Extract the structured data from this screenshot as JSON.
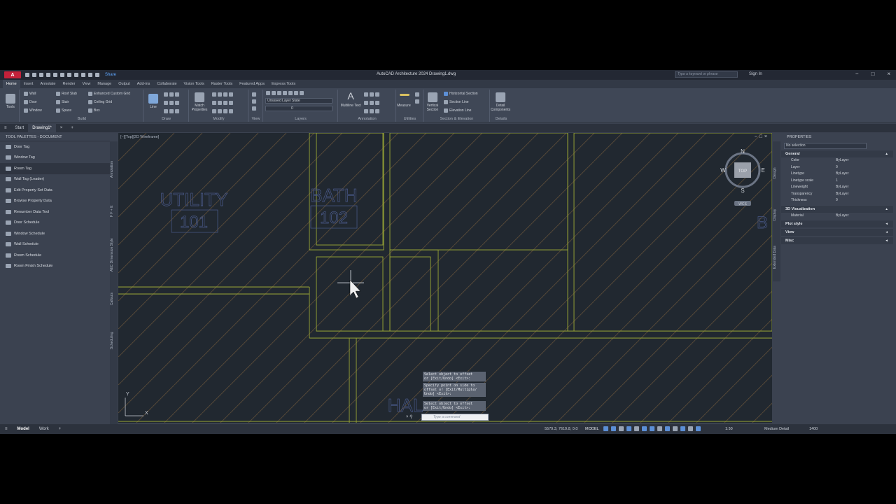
{
  "window": {
    "title": "AutoCAD Architecture 2024  Drawing1.dwg",
    "logo": "A",
    "share_label": "Share",
    "search_placeholder": "Type a keyword or phrase",
    "sign_in": "Sign In"
  },
  "menu_tabs": [
    "Home",
    "Insert",
    "Annotate",
    "Render",
    "View",
    "Manage",
    "Output",
    "Add-ins",
    "Collaborate",
    "Vision Tools",
    "Raster Tools",
    "Featured Apps",
    "Express Tools"
  ],
  "ribbon": {
    "tools_label": "Tools",
    "build": {
      "label": "Build",
      "items": [
        "Wall",
        "Roof Slab",
        "Enhanced Custom Grid",
        "Door",
        "Stair",
        "Ceiling Grid",
        "Window",
        "Space",
        "Box"
      ]
    },
    "draw": {
      "label": "Draw",
      "line": "Line"
    },
    "modify": {
      "label": "Modify",
      "match": "Match Properties"
    },
    "view": {
      "label": "View"
    },
    "layers": {
      "label": "Layers",
      "state": "Unsaved Layer State",
      "layer": "0"
    },
    "annotation": {
      "label": "Annotation",
      "text": "Multiline Text"
    },
    "utilities": {
      "label": "Utilities",
      "measure": "Measure"
    },
    "section": {
      "label": "Section & Elevation",
      "vertical": "Vertical Section",
      "items": [
        "Horizontal Section",
        "Section Line",
        "Elevation Line"
      ]
    },
    "details": {
      "label": "Details",
      "detail": "Detail Components"
    }
  },
  "doc_tabs": [
    "Start",
    "Drawing1*"
  ],
  "tool_palette": {
    "title": "TOOL PALETTES - DOCUMENT",
    "items": [
      "Door Tag",
      "Window Tag",
      "Room Tag",
      "Wall Tag (Leader)",
      "Edit Property Set Data",
      "Browse Property Data",
      "Renumber Data Tool",
      "Door Schedule",
      "Window Schedule",
      "Wall Schedule",
      "Room Schedule",
      "Room Finish Schedule"
    ],
    "selected": "Room Tag",
    "side_tabs": [
      "Annotation",
      "F F + E",
      "AEC Dimension Style",
      "Callouts",
      "Scheduling"
    ]
  },
  "viewport": {
    "label": "[−][Top][2D Wireframe]",
    "rooms": [
      {
        "name": "UTILITY",
        "number": "101"
      },
      {
        "name": "BATH",
        "number": "102"
      },
      {
        "name": "HAL"
      }
    ],
    "edge_letter": "B",
    "viewcube": {
      "top": "TOP",
      "n": "N",
      "s": "S",
      "e": "E",
      "w": "W",
      "wcs": "WCS"
    },
    "ucs": {
      "x": "X",
      "y": "Y"
    }
  },
  "command": {
    "history": [
      "Select object to offset\nor [Exit/Undo] <Exit>:",
      "Specify point on side to\noffset or [Exit/Multiple/\nUndo] <Exit>:",
      "Select object to offset\nor [Exit/Undo] <Exit>:"
    ],
    "placeholder": "Type a command"
  },
  "properties": {
    "title": "PROPERTIES",
    "selection": "No selection",
    "side_tabs": [
      "Design",
      "Display",
      "Extended Data"
    ],
    "sections": [
      {
        "name": "General",
        "expanded": true,
        "rows": [
          {
            "k": "Color",
            "v": "ByLayer"
          },
          {
            "k": "Layer",
            "v": "0"
          },
          {
            "k": "Linetype",
            "v": "ByLayer"
          },
          {
            "k": "Linetype scale",
            "v": "1"
          },
          {
            "k": "Lineweight",
            "v": "ByLayer"
          },
          {
            "k": "Transparency",
            "v": "ByLayer"
          },
          {
            "k": "Thickness",
            "v": "0"
          }
        ]
      },
      {
        "name": "3D Visualization",
        "expanded": true,
        "rows": [
          {
            "k": "Material",
            "v": "ByLayer"
          }
        ]
      },
      {
        "name": "Plot style",
        "expanded": false,
        "rows": []
      },
      {
        "name": "View",
        "expanded": false,
        "rows": []
      },
      {
        "name": "Misc",
        "expanded": false,
        "rows": []
      }
    ]
  },
  "status": {
    "tabs": [
      "Model",
      "Work"
    ],
    "coords": "5579.3, 7619.8, 0.0",
    "model": "MODEL",
    "scale": "1:50",
    "detail": "Medium Detail",
    "num": "1400"
  },
  "colors": {
    "wall": "#9ca836",
    "hatch": "#7a5e3c",
    "canvas": "#212830",
    "tag": "#4a5a8a"
  }
}
